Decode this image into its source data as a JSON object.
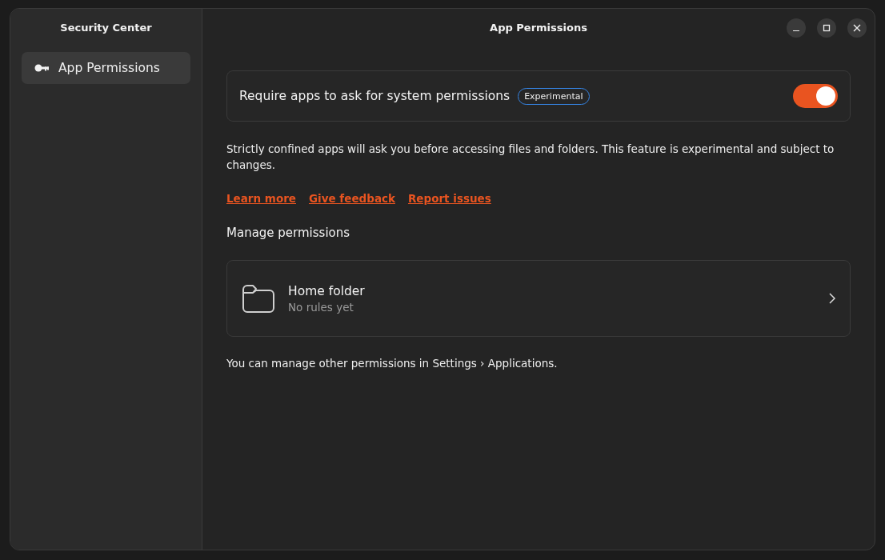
{
  "sidebar": {
    "title": "Security Center",
    "items": [
      {
        "label": "App Permissions",
        "selected": true
      }
    ]
  },
  "window": {
    "title": "App Permissions"
  },
  "permission_toggle": {
    "label": "Require apps to ask for system permissions",
    "badge": "Experimental",
    "on": true
  },
  "description": "Strictly confined apps will ask you before accessing files and folders. This feature is experimental and subject to changes.",
  "links": [
    "Learn more",
    "Give feedback",
    "Report issues"
  ],
  "manage": {
    "heading": "Manage permissions",
    "items": [
      {
        "title": "Home folder",
        "subtitle": "No rules yet"
      }
    ]
  },
  "footer_note": "You can manage other permissions in Settings › Applications."
}
